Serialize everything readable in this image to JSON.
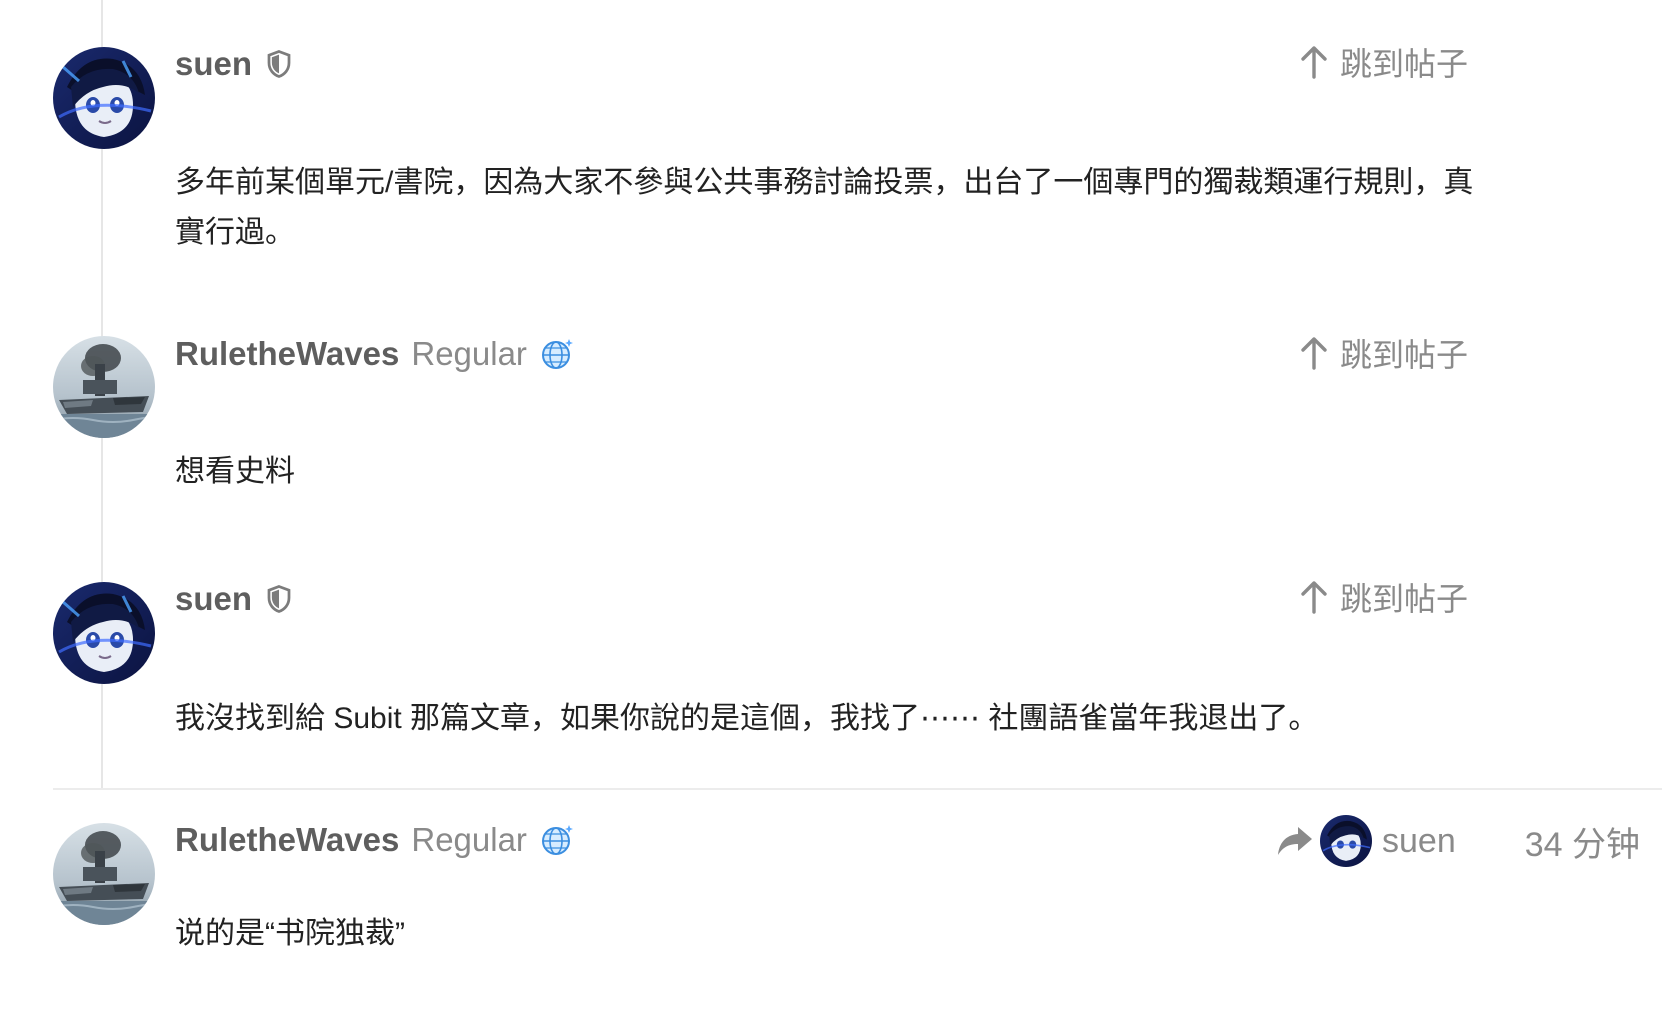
{
  "posts": [
    {
      "username": "suen",
      "title": "",
      "badge_icon": "shield-icon",
      "jump_label": "跳到帖子",
      "body": "多年前某個單元/書院，因為大家不參與公共事務討論投票，出台了一個專門的獨裁類運行規則，真實行過。"
    },
    {
      "username": "RuletheWaves",
      "title": "Regular",
      "badge_icon": "globe-icon",
      "jump_label": "跳到帖子",
      "body": "想看史料"
    },
    {
      "username": "suen",
      "title": "",
      "badge_icon": "shield-icon",
      "jump_label": "跳到帖子",
      "body": "我沒找到給 Subit 那篇文章，如果你說的是這個，我找了⋯⋯ 社團語雀當年我退出了。"
    },
    {
      "username": "RuletheWaves",
      "title": "Regular",
      "badge_icon": "globe-icon",
      "reply_to": "suen",
      "time": "34 分钟",
      "body": "说的是“书院独裁”"
    }
  ],
  "colors": {
    "username": "#5e5e5e",
    "muted": "#8a8a8a",
    "text": "#222222",
    "divider": "#e6e6e6"
  }
}
